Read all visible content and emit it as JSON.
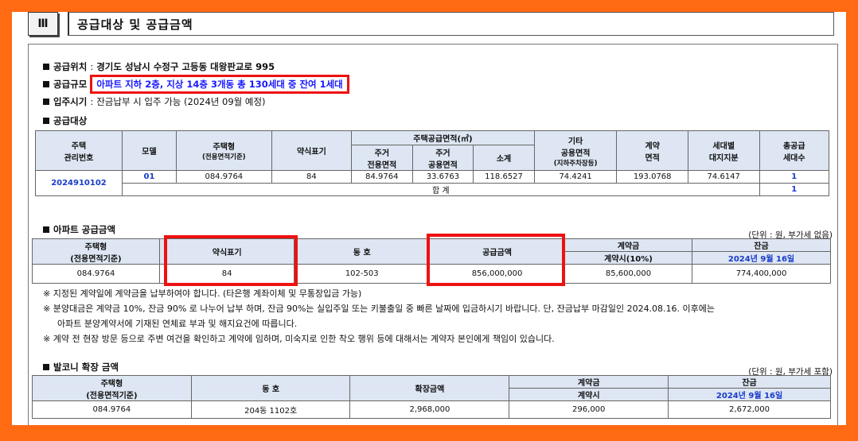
{
  "section": {
    "num": "Ⅲ",
    "title": "공급대상 및 공급금액"
  },
  "info": {
    "location_label": "공급위치",
    "location_value": "경기도 성남시 수정구 고등동 대왕판교로 995",
    "scale_label": "공급규모",
    "scale_value": "아파트 지하 2층, 지상 14층 3개동 총 130세대 중 잔여 1세대",
    "movein_label": "입주시기",
    "movein_value": "잔금납부 시 입주 가능 (2024년 09월 예정)",
    "target_label": "공급대상"
  },
  "target_table": {
    "h_mgmt": "주택\n관리번호",
    "h_model": "모델",
    "h_type": "주택형",
    "h_type_sub": "(전용면적기준)",
    "h_short": "약식표기",
    "h_area": "주택공급면적(㎡)",
    "h_excl": "주거\n전용면적",
    "h_common": "주거\n공용면적",
    "h_sub": "소계",
    "h_etc": "기타\n공용면적",
    "h_etc_sub": "(지하주차장등)",
    "h_contract": "계약\n면적",
    "h_land": "세대별\n대지지분",
    "h_total": "총공급\n세대수",
    "mgmt": "2024910102",
    "model": "01",
    "type": "084.9764",
    "short": "84",
    "excl": "84.9764",
    "common": "33.6763",
    "subtotal": "118.6527",
    "etc": "74.4241",
    "contract": "193.0768",
    "land": "74.6147",
    "units": "1",
    "sum_label": "합  계",
    "sum_units": "1"
  },
  "apt": {
    "title": "아파트 공급금액",
    "unit": "(단위 : 원, 부가세 없음)",
    "h_type": "주택형",
    "h_type_sub": "(전용면적기준)",
    "h_short": "약식표기",
    "h_dongho": "동  호",
    "h_price": "공급금액",
    "h_deposit": "계약금",
    "h_deposit_sub": "계약시(10%)",
    "h_balance": "잔금",
    "h_balance_date": "2024년  9월  16일",
    "type": "084.9764",
    "short": "84",
    "dongho": "102-503",
    "price": "856,000,000",
    "deposit": "85,600,000",
    "balance": "774,400,000"
  },
  "notes": [
    "※ 지정된 계약일에 계약금을 납부하여야 합니다. (타은행 계좌이체 및 무통장입금 가능)",
    "※ 분양대금은 계약금 10%, 잔금 90% 로 나누어 납부 하며, 잔금 90%는 실입주일 또는 키불출일 중 빠른 날짜에 입금하시기 바랍니다. 단, 잔금납부 마감일인 2024.08.16. 이후에는",
    "아파트 분양계약서에 기재된 연체료 부과 및 해지요건에 따릅니다.",
    "※ 계약 전 현장 방문 등으로 주변 여건을 확인하고 계약에 임하며, 미숙지로 인한 착오 행위 등에 대해서는 계약자 본인에게 책임이 있습니다."
  ],
  "balcony": {
    "title": "발코니 확장 금액",
    "unit": "(단위 : 원, 부가세 포함)",
    "h_type": "주택형",
    "h_type_sub": "(전용면적기준)",
    "h_dongho": "동  호",
    "h_amount": "확장금액",
    "h_deposit": "계약금",
    "h_deposit_sub": "계약시",
    "h_balance": "잔금",
    "h_balance_date": "2024년  9월  16일",
    "type": "084.9764",
    "dongho": "204동  1102호",
    "amount": "2,968,000",
    "deposit": "296,000",
    "balance": "2,672,000"
  }
}
